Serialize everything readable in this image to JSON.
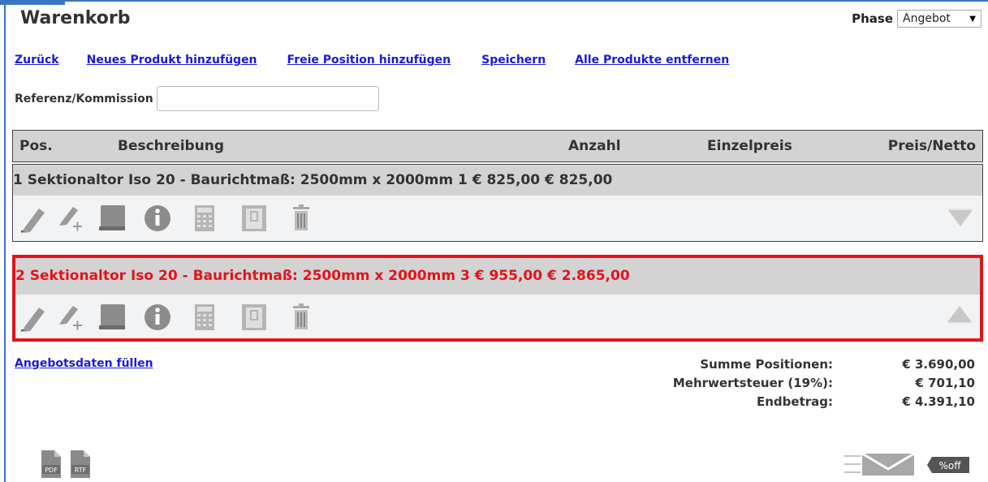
{
  "title": "Warenkorb",
  "phase": {
    "label": "Phase",
    "selected": "Angebot"
  },
  "links": [
    "Zurück",
    "Neues Produkt hinzufügen",
    "Freie Position hinzufügen",
    "Speichern",
    "Alle Produkte entfernen"
  ],
  "reference": {
    "label": "Referenz/Kommission",
    "value": ""
  },
  "table": {
    "headers": {
      "pos": "Pos.",
      "desc": "Beschreibung",
      "qty": "Anzahl",
      "unit": "Einzelpreis",
      "net": "Preis/Netto"
    },
    "rows": [
      {
        "pos": "1",
        "desc": "Sektionaltor Iso 20 - Baurichtmaß: 2500mm x 2000mm",
        "qty": "1",
        "unit": "€ 825,00",
        "net": "€ 825,00"
      },
      {
        "pos": "2",
        "desc": "Sektionaltor Iso 20 - Baurichtmaß: 2500mm x 2000mm",
        "qty": "3",
        "unit": "€ 955,00",
        "net": "€ 2.865,00"
      }
    ],
    "toolbar_icons": [
      "edit-icon",
      "add-edit-icon",
      "book-icon",
      "info-icon",
      "calculator-icon",
      "door-icon",
      "trash-icon"
    ]
  },
  "offer_link": "Angebotsdaten füllen",
  "summary": [
    {
      "label": "Summe Positionen:",
      "value": "€ 3.690,00"
    },
    {
      "label": "Mehrwertsteuer (19%):",
      "value": "€ 701,10"
    },
    {
      "label": "Endbetrag:",
      "value": "€ 4.391,10"
    }
  ],
  "export": {
    "pdf": "PDF",
    "rtf": "RTF",
    "discount": "%off"
  },
  "colors": {
    "highlight": "#e0141c",
    "link": "#1a1ad8",
    "header_bg": "#d3d3d3",
    "frame": "#3a75c4"
  }
}
